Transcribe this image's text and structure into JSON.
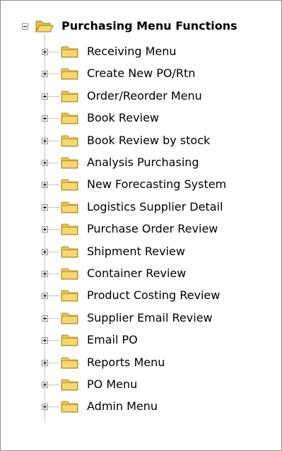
{
  "tree": {
    "root": {
      "label": "Purchasing Menu Functions",
      "icon": "open-folder-icon",
      "expanded": true
    },
    "items": [
      {
        "label": "Receiving Menu",
        "icon": "folder-icon"
      },
      {
        "label": "Create New PO/Rtn",
        "icon": "folder-icon"
      },
      {
        "label": "Order/Reorder Menu",
        "icon": "folder-icon"
      },
      {
        "label": "Book Review",
        "icon": "folder-icon"
      },
      {
        "label": "Book Review by stock",
        "icon": "folder-icon"
      },
      {
        "label": "Analysis Purchasing",
        "icon": "folder-icon"
      },
      {
        "label": "New Forecasting System",
        "icon": "folder-icon"
      },
      {
        "label": "Logistics Supplier Detail",
        "icon": "folder-icon"
      },
      {
        "label": "Purchase Order Review",
        "icon": "folder-icon"
      },
      {
        "label": "Shipment Review",
        "icon": "folder-icon"
      },
      {
        "label": "Container Review",
        "icon": "folder-icon"
      },
      {
        "label": "Product Costing Review",
        "icon": "folder-icon"
      },
      {
        "label": "Supplier Email Review",
        "icon": "folder-icon"
      },
      {
        "label": "Email PO",
        "icon": "folder-icon"
      },
      {
        "label": "Reports Menu",
        "icon": "folder-icon"
      },
      {
        "label": "PO Menu",
        "icon": "folder-icon"
      },
      {
        "label": "Admin Menu",
        "icon": "folder-icon"
      }
    ]
  },
  "colors": {
    "folder_fill": "#f7d774",
    "folder_stroke": "#b8942a",
    "tree_line": "#8e8e8e"
  }
}
